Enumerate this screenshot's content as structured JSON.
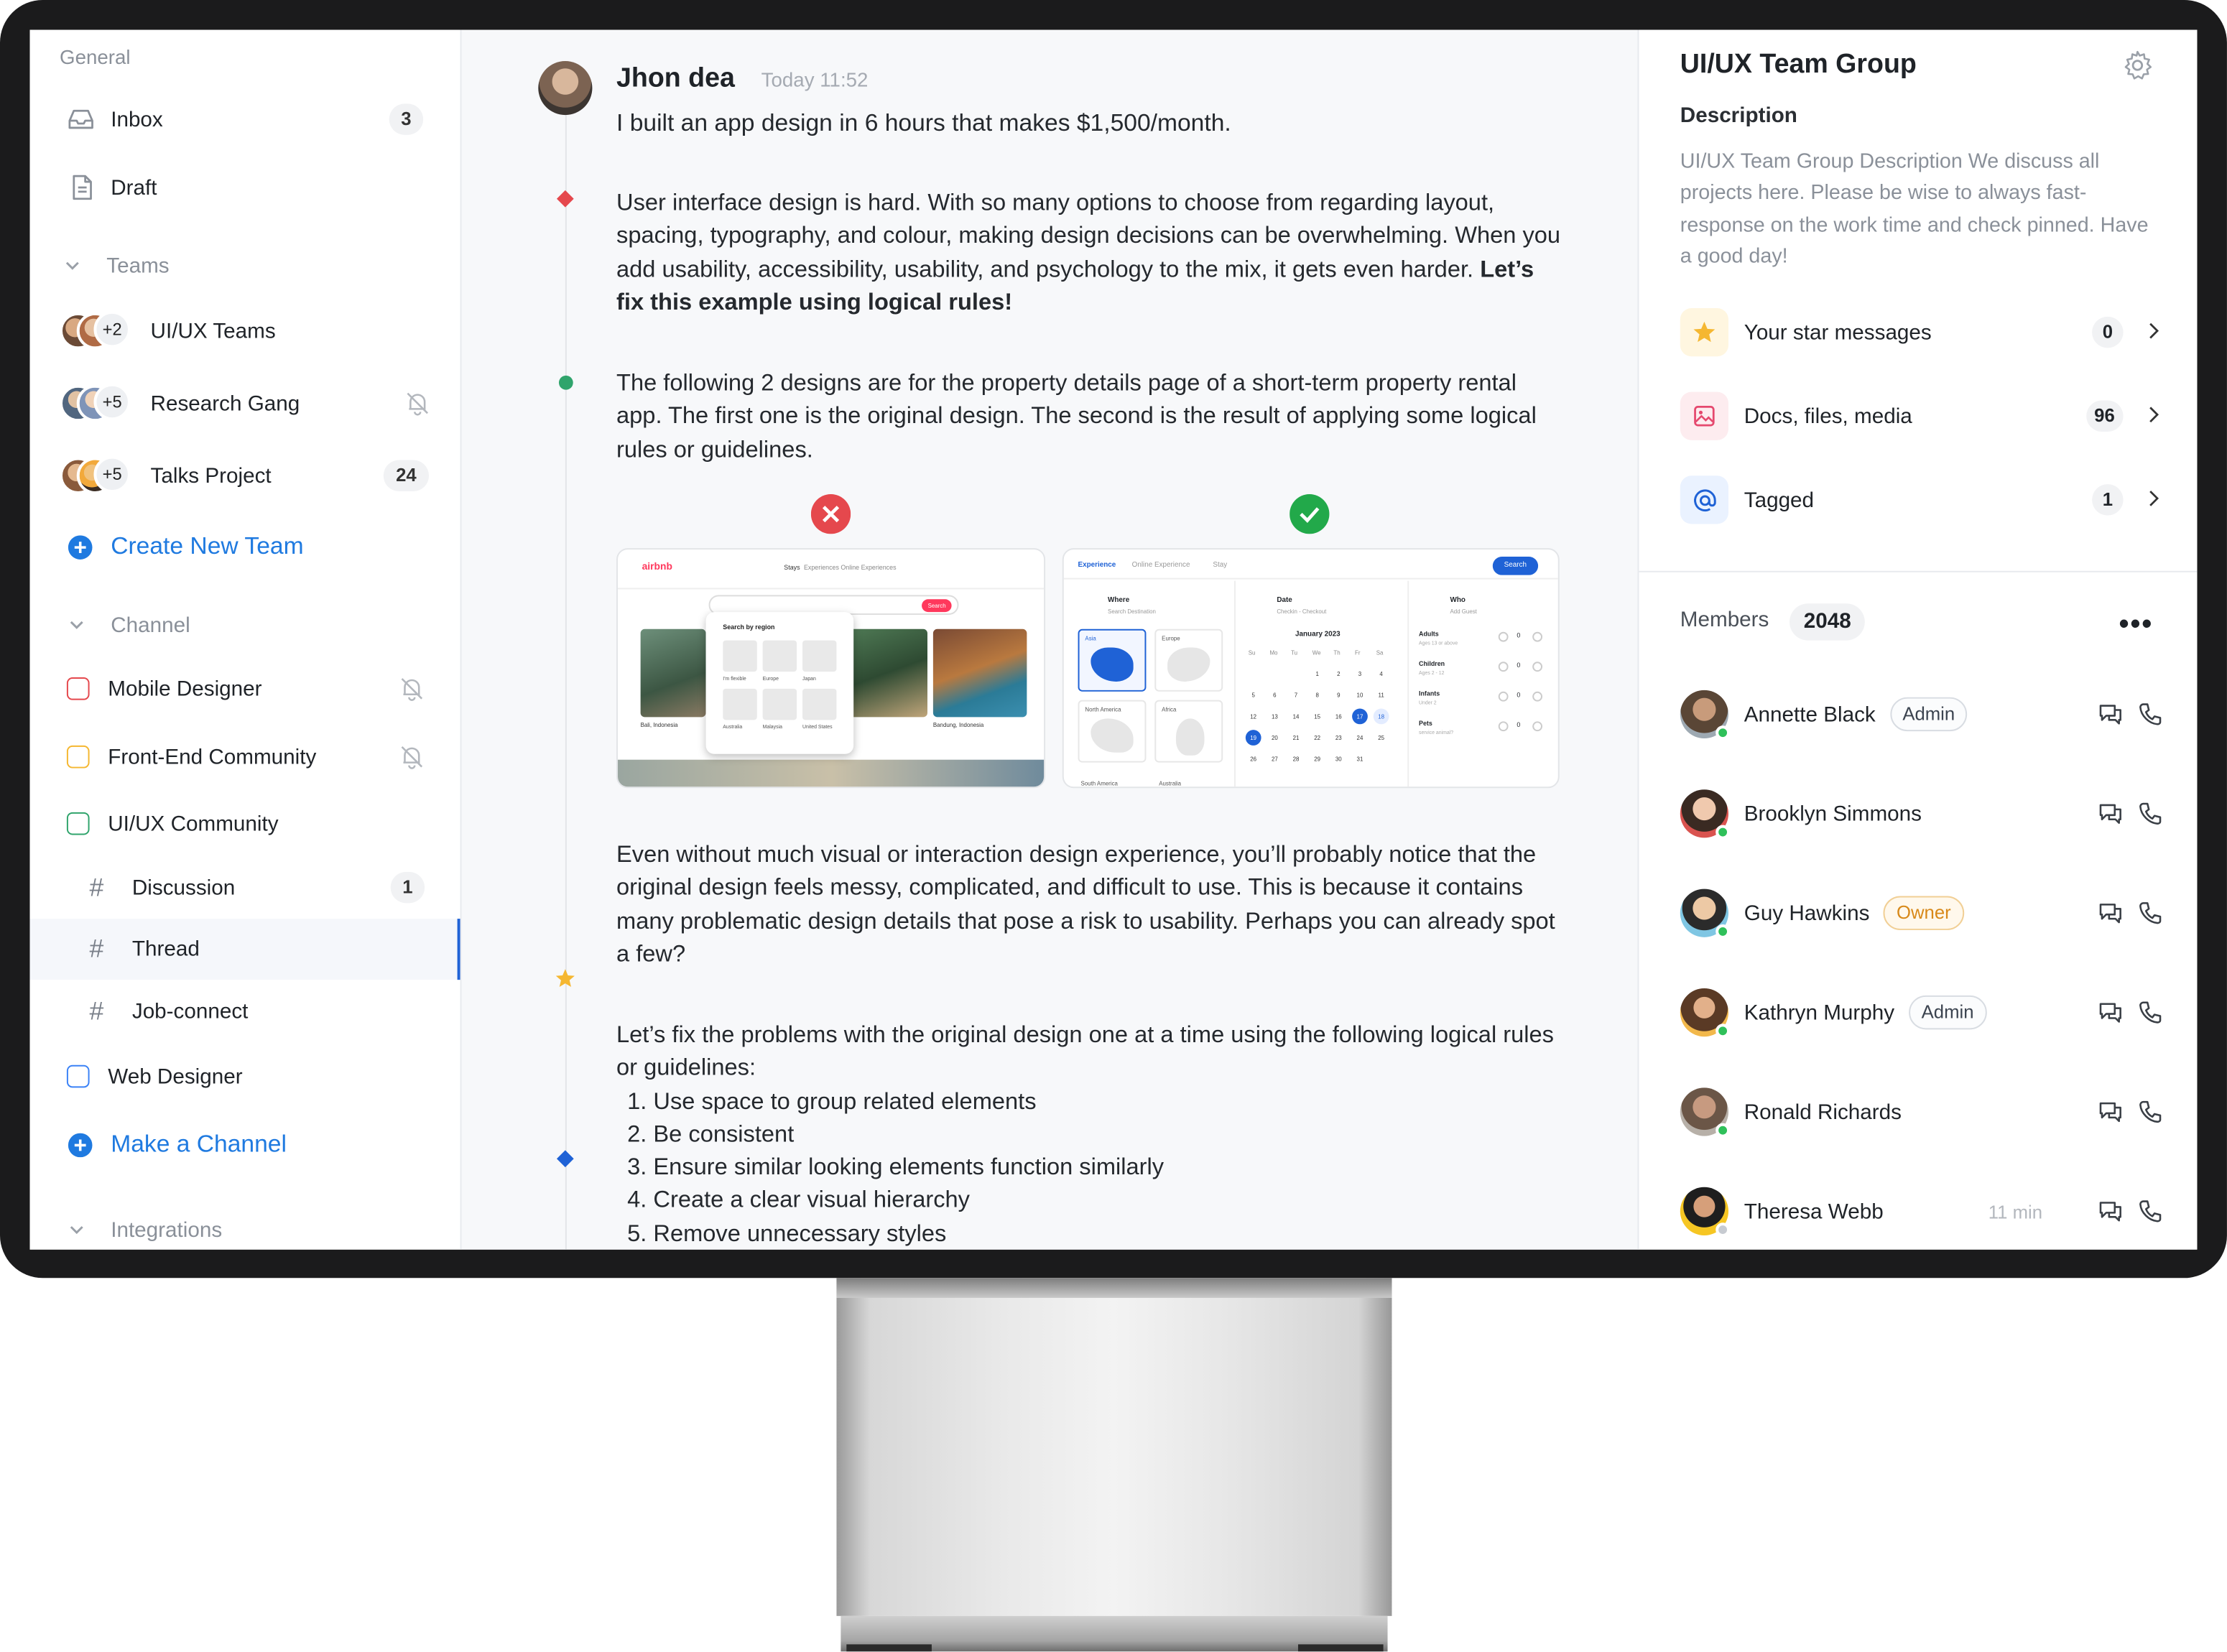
{
  "sidebar": {
    "general_label": "General",
    "inbox": {
      "label": "Inbox",
      "count": "3"
    },
    "draft": {
      "label": "Draft"
    },
    "teams_label": "Teams",
    "teams": [
      {
        "label": "UI/UX Teams",
        "extra": "+2",
        "count": ""
      },
      {
        "label": "Research Gang",
        "extra": "+5",
        "count": ""
      },
      {
        "label": "Talks Project",
        "extra": "+5",
        "count": "24"
      }
    ],
    "create_team": "Create New Team",
    "channel_label": "Channel",
    "channels": [
      {
        "label": "Mobile Designer",
        "color": "#e5484d"
      },
      {
        "label": "Front-End Community",
        "color": "#f5b731"
      },
      {
        "label": "UI/UX Community",
        "color": "#30a46c"
      }
    ],
    "subchannels": [
      {
        "label": "Discussion",
        "count": "1"
      },
      {
        "label": "Thread",
        "count": ""
      },
      {
        "label": "Job-connect",
        "count": ""
      }
    ],
    "web_designer": {
      "label": "Web Designer",
      "color": "#3b82f6"
    },
    "make_channel": "Make a Channel",
    "integrations_label": "Integrations"
  },
  "message": {
    "author": "Jhon dea",
    "time": "Today 11:52",
    "headline": "I built an app design in 6 hours that makes $1,500/month.",
    "p1": "User interface design is hard. With so many options to choose from regarding layout, spacing, typography, and colour, making design decisions can be overwhelming. When you add usability, accessibility, usability, and psychology to the mix, it gets even harder.",
    "p1_bold": "Let’s fix this example using logical rules!",
    "p2": "The following 2 designs are for the property details page of a short-term property rental app. The first one is the original design. The second is the result of applying some logical rules or guidelines.",
    "p3": "Even without much visual or interaction design experience, you’ll probably notice that the original design feels messy, complicated, and difficult to use. This is because it contains many problematic design details that pose a risk to usability. Perhaps you can already spot a few?",
    "p4": "Let’s fix the problems with the original design one at a time using the following logical rules or guidelines:",
    "rules": [
      "Use space to group related elements",
      "Be consistent",
      "Ensure similar looking elements function similarly",
      "Create a clear visual hierarchy",
      "Remove unnecessary styles"
    ],
    "shot_left": {
      "brand": "airbnb",
      "nav": [
        "Stays",
        "Experiences",
        "Online Experiences"
      ],
      "search_btn": "Search",
      "popup_title": "Search by region",
      "regions": [
        "I'm flexible",
        "Europe",
        "Japan",
        "Australia",
        "Malaysia",
        "United States"
      ],
      "listings": [
        "Bali, Indonesia",
        "Bandung, Indonesia"
      ]
    },
    "shot_right": {
      "tabs": [
        "Experience",
        "Online Experience",
        "Stay"
      ],
      "search_btn": "Search",
      "where": "Where",
      "where_sub": "Search Destination",
      "date": "Date",
      "date_sub": "Checkin - Checkout",
      "who": "Who",
      "who_sub": "Add Guest",
      "regions": [
        "Asia",
        "Europe",
        "North America",
        "Africa",
        "South America",
        "Australia"
      ],
      "month": "January 2023",
      "weekdays": [
        "Su",
        "Mo",
        "Tu",
        "We",
        "Th",
        "Fr",
        "Sa"
      ],
      "guests": [
        {
          "label": "Adults",
          "sub": "Ages 13 or above",
          "val": "0"
        },
        {
          "label": "Children",
          "sub": "Ages 2 - 12",
          "val": "0"
        },
        {
          "label": "Infants",
          "sub": "Under 2",
          "val": "0"
        },
        {
          "label": "Pets",
          "sub": "service animal?",
          "val": "0"
        }
      ]
    }
  },
  "group": {
    "title": "UI/UX Team Group",
    "desc_heading": "Description",
    "description": "UI/UX Team Group Description We discuss all projects here. Please be wise to always fast-response on the work time and check pinned. Have a good day!",
    "quick": [
      {
        "label": "Your star messages",
        "count": "0",
        "icon": "star-icon"
      },
      {
        "label": "Docs, files, media",
        "count": "96",
        "icon": "image-icon"
      },
      {
        "label": "Tagged",
        "count": "1",
        "icon": "at-icon"
      }
    ],
    "members_label": "Members",
    "members_count": "2048",
    "members": [
      {
        "name": "Annette Black",
        "role": "Admin",
        "time": ""
      },
      {
        "name": "Brooklyn Simmons",
        "role": "",
        "time": ""
      },
      {
        "name": "Guy Hawkins",
        "role": "Owner",
        "time": ""
      },
      {
        "name": "Kathryn Murphy",
        "role": "Admin",
        "time": ""
      },
      {
        "name": "Ronald Richards",
        "role": "",
        "time": ""
      },
      {
        "name": "Theresa Webb",
        "role": "",
        "time": "11 min"
      }
    ]
  },
  "colors": {
    "accent": "#1f7ae0",
    "selected_border": "#1f62d6",
    "online": "#2fc05a"
  }
}
